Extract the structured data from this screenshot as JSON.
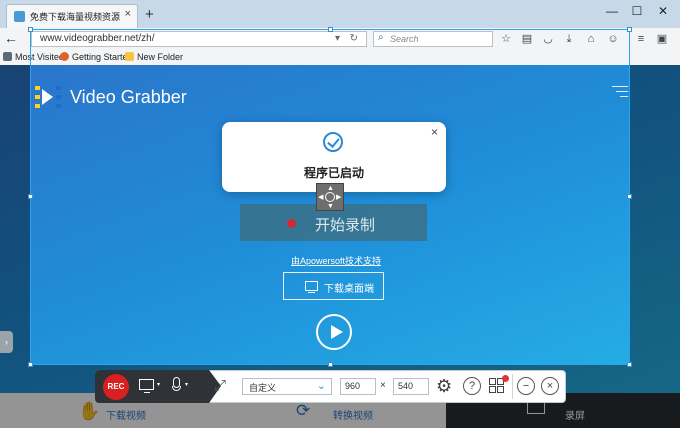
{
  "browser": {
    "tab_title": "免费下载海量视频资源",
    "tab_close": "×",
    "new_tab": "+",
    "window_controls": {
      "minimize": "—",
      "maximize": "☐",
      "close": "✕"
    },
    "back": "←",
    "url": "www.videograbber.net/zh/",
    "url_dropdown": "▾",
    "reload": "↻",
    "search_placeholder": "Search",
    "toolbar_icons": [
      "star-icon",
      "clipboard-icon",
      "pocket-icon",
      "download-icon",
      "home-icon",
      "chat-icon",
      "menu-icon",
      "hamburger-icon"
    ],
    "bookmarks": [
      {
        "label": "Most Visited",
        "color": "#5a6a7a"
      },
      {
        "label": "Getting Started",
        "color": "#e2622a"
      },
      {
        "label": "New Folder",
        "color": "#f3c63d"
      }
    ]
  },
  "site": {
    "logo_text": "Video Grabber",
    "start_record": "开始录制",
    "support_link": "由Apowersoft技术支持",
    "download_desktop": "下载桌面端",
    "bottom_tabs": [
      "下载视频",
      "转换视频",
      "录屏"
    ]
  },
  "popup": {
    "message": "程序已启动",
    "close": "×"
  },
  "recorder_toolbar": {
    "rec_label": "REC",
    "size_preset": "自定义",
    "width": "960",
    "height": "540",
    "times": "×",
    "help": "?",
    "minimize": "−",
    "close": "×"
  },
  "colors": {
    "accent": "#2aa5f0",
    "rec_red": "#d82020",
    "page_blue": "#1f8ed9"
  }
}
